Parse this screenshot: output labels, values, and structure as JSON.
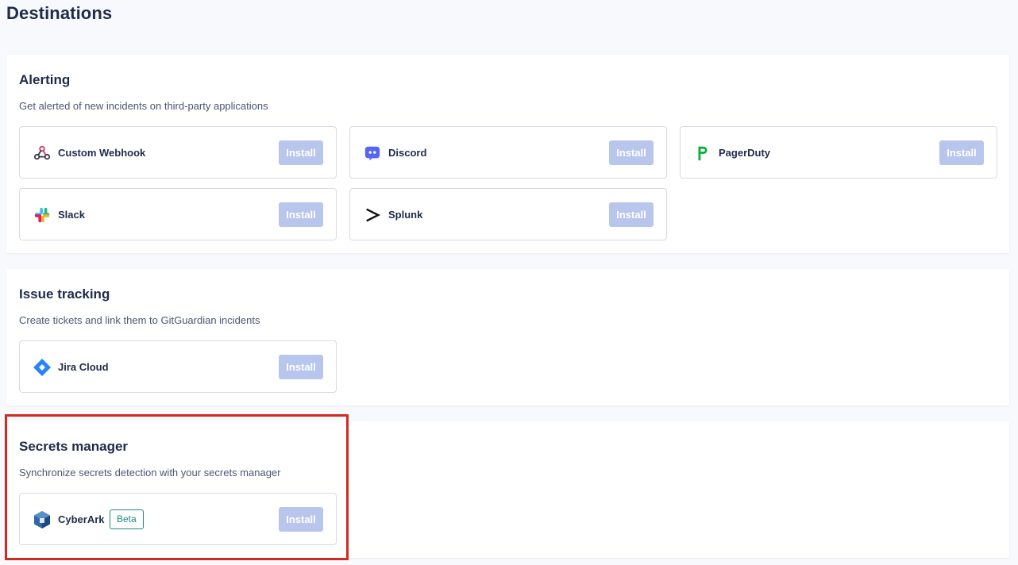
{
  "page": {
    "title": "Destinations"
  },
  "sections": [
    {
      "title": "Alerting",
      "description": "Get alerted of new incidents on third-party applications",
      "cards": [
        {
          "name": "Custom Webhook",
          "icon": "webhook-icon",
          "button": "Install"
        },
        {
          "name": "Discord",
          "icon": "discord-icon",
          "button": "Install"
        },
        {
          "name": "PagerDuty",
          "icon": "pagerduty-icon",
          "button": "Install"
        },
        {
          "name": "Slack",
          "icon": "slack-icon",
          "button": "Install"
        },
        {
          "name": "Splunk",
          "icon": "splunk-icon",
          "button": "Install"
        }
      ]
    },
    {
      "title": "Issue tracking",
      "description": "Create tickets and link them to GitGuardian incidents",
      "cards": [
        {
          "name": "Jira Cloud",
          "icon": "jira-icon",
          "button": "Install"
        }
      ]
    },
    {
      "title": "Secrets manager",
      "description": "Synchronize secrets detection with your secrets manager",
      "cards": [
        {
          "name": "CyberArk",
          "badge": "Beta",
          "icon": "cyberark-icon",
          "button": "Install"
        }
      ]
    }
  ],
  "colors": {
    "install_button_bg": "#b8c6ee",
    "beta_badge": "#1b8c7e",
    "highlight_border": "#d22a22"
  }
}
